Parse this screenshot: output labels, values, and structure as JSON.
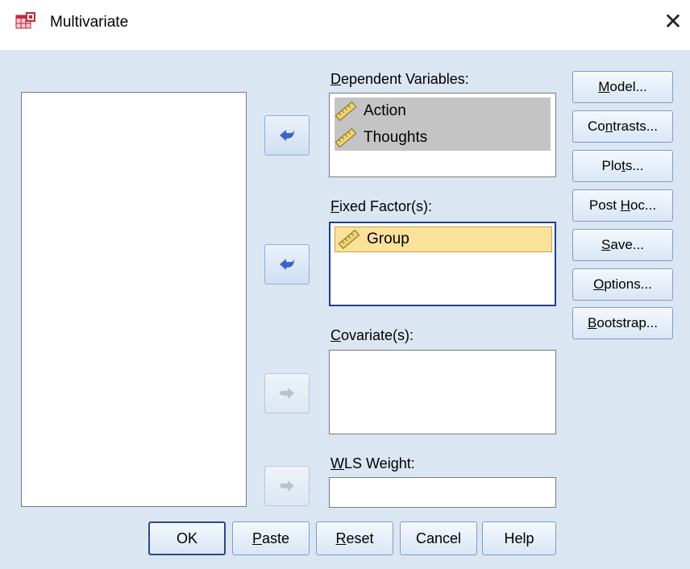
{
  "window": {
    "title": "Multivariate",
    "close_glyph": "✕",
    "icon": "spss-table-icon"
  },
  "fields": {
    "dependent": {
      "label_pre": "",
      "label_ul": "D",
      "label_post": "ependent Variables:",
      "items": [
        "Action",
        "Thoughts"
      ],
      "item_icon": "ruler-scale-icon"
    },
    "fixed": {
      "label_pre": "",
      "label_ul": "F",
      "label_post": "ixed Factor(s):",
      "items": [
        "Group"
      ],
      "item_icon": "ruler-scale-icon"
    },
    "covariate": {
      "label_pre": "",
      "label_ul": "C",
      "label_post": "ovariate(s):"
    },
    "wls": {
      "label_pre": "",
      "label_ul": "W",
      "label_post": "LS Weight:",
      "value": ""
    }
  },
  "side_buttons": {
    "model": {
      "pre": "",
      "ul": "M",
      "post": "odel..."
    },
    "contrasts": {
      "pre": "Co",
      "ul": "n",
      "post": "trasts..."
    },
    "plots": {
      "pre": "Plo",
      "ul": "t",
      "post": "s..."
    },
    "posthoc": {
      "pre": "Post ",
      "ul": "H",
      "post": "oc..."
    },
    "save": {
      "pre": "",
      "ul": "S",
      "post": "ave..."
    },
    "options": {
      "pre": "",
      "ul": "O",
      "post": "ptions..."
    },
    "bootstrap": {
      "pre": "",
      "ul": "B",
      "post": "ootstrap..."
    }
  },
  "bottom_buttons": {
    "ok": {
      "pre": "OK",
      "ul": "",
      "post": ""
    },
    "paste": {
      "pre": "",
      "ul": "P",
      "post": "aste"
    },
    "reset": {
      "pre": "",
      "ul": "R",
      "post": "eset"
    },
    "cancel": {
      "pre": "Cancel",
      "ul": "",
      "post": ""
    },
    "help": {
      "pre": "Help",
      "ul": "",
      "post": ""
    }
  },
  "colors": {
    "dialog_bg": "#dbe6f3",
    "selection_grey": "#c4c4c4",
    "selection_yellow": "#fbe19a",
    "arrow_active": "#3d63c9",
    "arrow_disabled": "#b9c3cf"
  }
}
